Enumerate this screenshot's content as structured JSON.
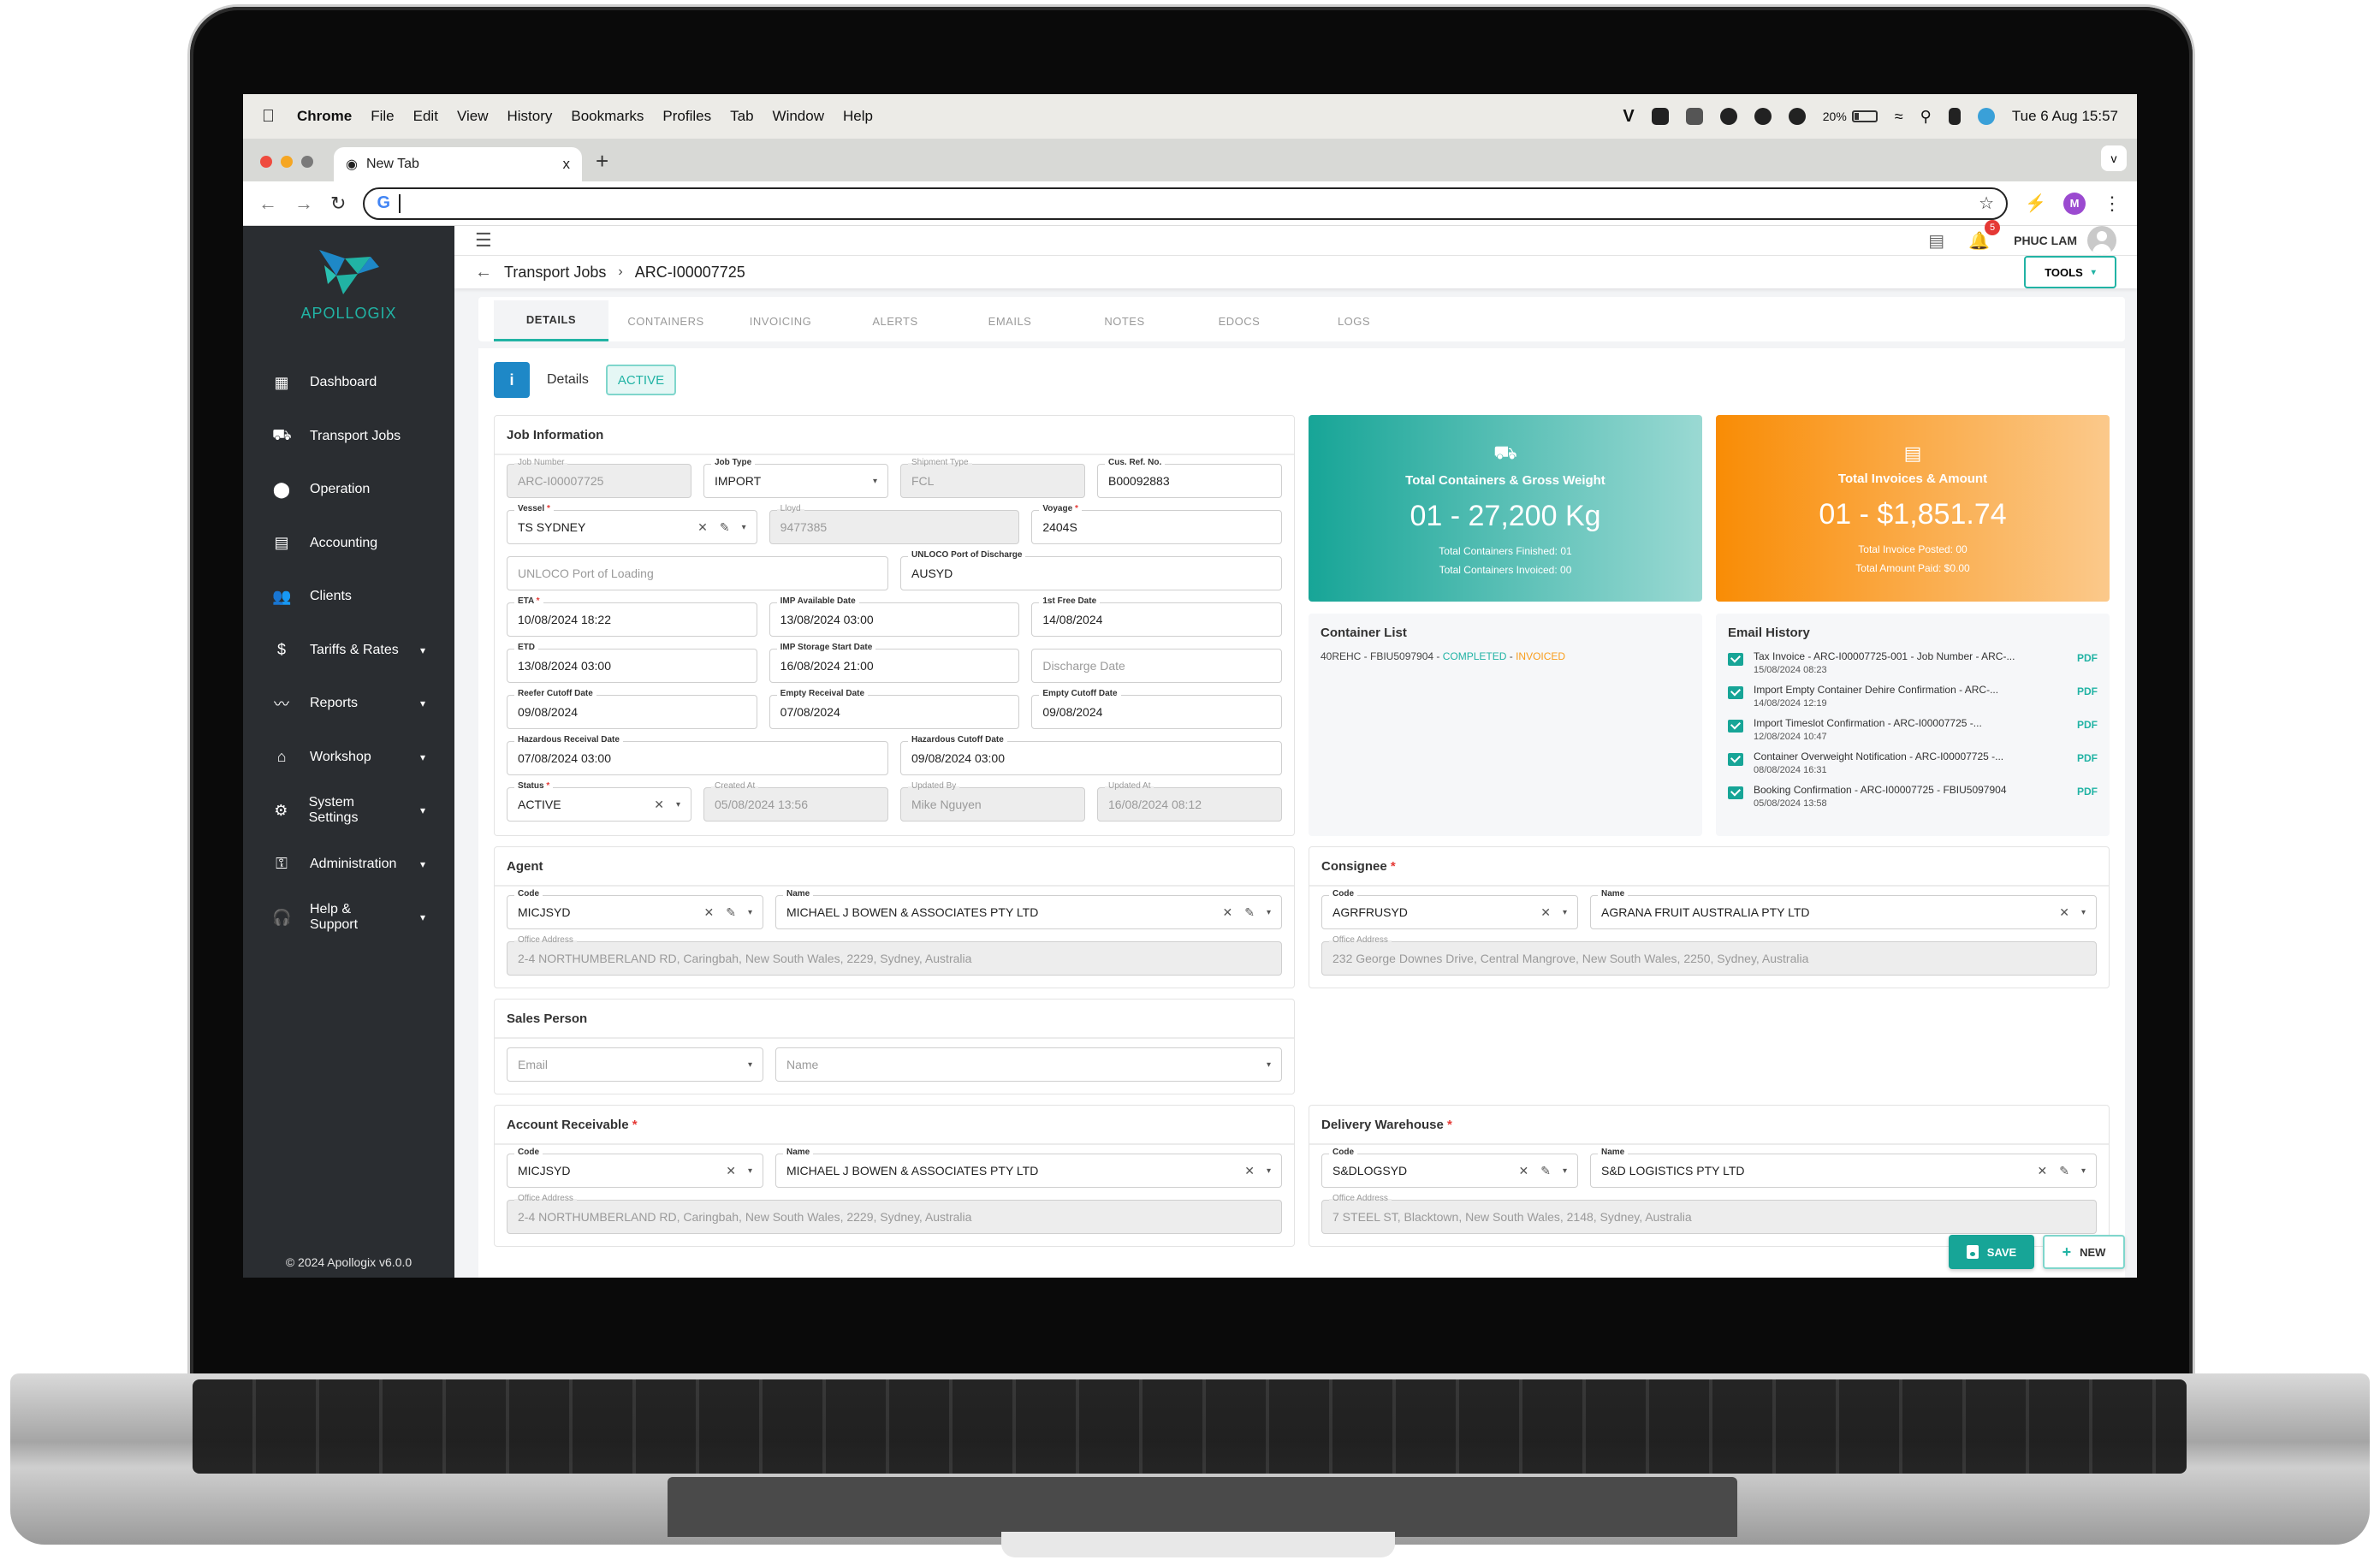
{
  "menubar": {
    "app_name": "Chrome",
    "items": [
      "File",
      "Edit",
      "View",
      "History",
      "Bookmarks",
      "Profiles",
      "Tab",
      "Window",
      "Help"
    ],
    "battery_percent": "20%",
    "datetime": "Tue 6 Aug  15:57",
    "tray_letter": "V"
  },
  "browser": {
    "tab_title": "New Tab",
    "tab_close": "x",
    "new_tab": "+",
    "tab_dropdown": "v",
    "address_value": "",
    "profile_initial": "M"
  },
  "sidebar": {
    "brand": "APOLLOGIX",
    "items": [
      {
        "label": "Dashboard",
        "icon": "dashboard-icon",
        "glyph": "▦",
        "expandable": false
      },
      {
        "label": "Transport Jobs",
        "icon": "truck-icon",
        "glyph": "⛟",
        "expandable": false
      },
      {
        "label": "Operation",
        "icon": "location-pin-icon",
        "glyph": "⬤",
        "expandable": false
      },
      {
        "label": "Accounting",
        "icon": "ledger-icon",
        "glyph": "▤",
        "expandable": false
      },
      {
        "label": "Clients",
        "icon": "people-icon",
        "glyph": "👥",
        "expandable": false
      },
      {
        "label": "Tariffs & Rates",
        "icon": "dollar-icon",
        "glyph": "$",
        "expandable": true
      },
      {
        "label": "Reports",
        "icon": "trend-line-icon",
        "glyph": "〰",
        "expandable": true
      },
      {
        "label": "Workshop",
        "icon": "workshop-icon",
        "glyph": "⌂",
        "expandable": true
      },
      {
        "label": "System Settings",
        "icon": "gear-icon",
        "glyph": "⚙",
        "expandable": true
      },
      {
        "label": "Administration",
        "icon": "key-icon",
        "glyph": "⚿",
        "expandable": true
      },
      {
        "label": "Help & Support",
        "icon": "headset-icon",
        "glyph": "🎧",
        "expandable": true
      }
    ],
    "chevron": "▾",
    "footer": "© 2024 Apollogix v6.0.0"
  },
  "topbar": {
    "notification_count": "5",
    "user_name": "PHUC LAM"
  },
  "breadcrumb": {
    "parent": "Transport Jobs",
    "separator": "›",
    "current": "ARC-I00007725",
    "tools_label": "TOOLS"
  },
  "tabs": [
    {
      "label": "DETAILS",
      "active": true
    },
    {
      "label": "CONTAINERS",
      "active": false
    },
    {
      "label": "INVOICING",
      "active": false
    },
    {
      "label": "ALERTS",
      "active": false
    },
    {
      "label": "EMAILS",
      "active": false
    },
    {
      "label": "NOTES",
      "active": false
    },
    {
      "label": "EDOCS",
      "active": false
    },
    {
      "label": "LOGS",
      "active": false
    }
  ],
  "details": {
    "info_glyph": "i",
    "label": "Details",
    "status_chip": "ACTIVE"
  },
  "job_information": {
    "title": "Job Information",
    "job_number": {
      "label": "Job Number",
      "value": "ARC-I00007725"
    },
    "job_type": {
      "label": "Job Type",
      "value": "IMPORT"
    },
    "shipment_type": {
      "label": "Shipment Type",
      "value": "FCL"
    },
    "cus_ref_no": {
      "label": "Cus. Ref. No.",
      "value": "B00092883"
    },
    "vessel": {
      "label": "Vessel",
      "value": "TS SYDNEY"
    },
    "lloyd": {
      "label": "Lloyd",
      "value": "9477385"
    },
    "voyage": {
      "label": "Voyage",
      "value": "2404S"
    },
    "port_of_loading": {
      "placeholder": "UNLOCO Port of Loading"
    },
    "port_of_discharge": {
      "label": "UNLOCO Port of Discharge",
      "value": "AUSYD"
    },
    "eta": {
      "label": "ETA",
      "value": "10/08/2024 18:22"
    },
    "imp_available_date": {
      "label": "IMP Available Date",
      "value": "13/08/2024 03:00"
    },
    "first_free_date": {
      "label": "1st Free Date",
      "value": "14/08/2024"
    },
    "etd": {
      "label": "ETD",
      "value": "13/08/2024 03:00"
    },
    "imp_storage_start_date": {
      "label": "IMP Storage Start Date",
      "value": "16/08/2024 21:00"
    },
    "discharge_date": {
      "placeholder": "Discharge Date"
    },
    "reefer_cutoff_date": {
      "label": "Reefer Cutoff Date",
      "value": "09/08/2024"
    },
    "empty_receival_date": {
      "label": "Empty Receival Date",
      "value": "07/08/2024"
    },
    "empty_cutoff_date": {
      "label": "Empty Cutoff Date",
      "value": "09/08/2024"
    },
    "hazardous_receival_date": {
      "label": "Hazardous Receival Date",
      "value": "07/08/2024 03:00"
    },
    "hazardous_cutoff_date": {
      "label": "Hazardous Cutoff Date",
      "value": "09/08/2024 03:00"
    },
    "status": {
      "label": "Status",
      "value": "ACTIVE"
    },
    "created_at": {
      "label": "Created At",
      "value": "05/08/2024 13:56"
    },
    "updated_by": {
      "label": "Updated By",
      "value": "Mike Nguyen"
    },
    "updated_at": {
      "label": "Updated At",
      "value": "16/08/2024 08:12"
    }
  },
  "stats": {
    "containers": {
      "title": "Total Containers & Gross Weight",
      "value": "01 - 27,200 Kg",
      "line1": "Total Containers Finished: 01",
      "line2": "Total Containers Invoiced: 00",
      "color": "#17a597"
    },
    "invoices": {
      "title": "Total Invoices & Amount",
      "value": "01 - $1,851.74",
      "line1": "Total Invoice Posted: 00",
      "line2": "Total Amount Paid: $0.00",
      "color": "#f98c05"
    }
  },
  "container_list": {
    "title": "Container List",
    "items": [
      {
        "prefix": "40REHC - FBIU5097904 - ",
        "status": "COMPLETED",
        "sep": " - ",
        "billing": "INVOICED"
      }
    ]
  },
  "email_history": {
    "title": "Email History",
    "link_label": "PDF",
    "items": [
      {
        "subject": "Tax Invoice - ARC-I00007725-001 - Job Number - ARC-...",
        "date": "15/08/2024 08:23"
      },
      {
        "subject": "Import Empty Container Dehire Confirmation - ARC-...",
        "date": "14/08/2024 12:19"
      },
      {
        "subject": "Import Timeslot Confirmation - ARC-I00007725 -...",
        "date": "12/08/2024 10:47"
      },
      {
        "subject": "Container Overweight Notification - ARC-I00007725 -...",
        "date": "08/08/2024 16:31"
      },
      {
        "subject": "Booking Confirmation - ARC-I00007725 - FBIU5097904",
        "date": "05/08/2024 13:58"
      }
    ]
  },
  "agent": {
    "title": "Agent",
    "code": {
      "label": "Code",
      "value": "MICJSYD"
    },
    "name": {
      "label": "Name",
      "value": "MICHAEL J BOWEN & ASSOCIATES PTY LTD"
    },
    "address": {
      "label": "Office Address",
      "value": "2-4 NORTHUMBERLAND RD, Caringbah, New South Wales, 2229, Sydney, Australia"
    }
  },
  "consignee": {
    "title": "Consignee",
    "code": {
      "label": "Code",
      "value": "AGRFRUSYD"
    },
    "name": {
      "label": "Name",
      "value": "AGRANA FRUIT AUSTRALIA PTY LTD"
    },
    "address": {
      "label": "Office Address",
      "value": "232 George Downes Drive, Central Mangrove, New South Wales, 2250, Sydney, Australia"
    }
  },
  "sales_person": {
    "title": "Sales Person",
    "email_placeholder": "Email",
    "name_placeholder": "Name"
  },
  "account_receivable": {
    "title": "Account Receivable",
    "code": {
      "label": "Code",
      "value": "MICJSYD"
    },
    "name": {
      "label": "Name",
      "value": "MICHAEL J BOWEN & ASSOCIATES PTY LTD"
    },
    "address": {
      "label": "Office Address",
      "value": "2-4 NORTHUMBERLAND RD, Caringbah, New South Wales, 2229, Sydney, Australia"
    }
  },
  "delivery_warehouse": {
    "title": "Delivery Warehouse",
    "code": {
      "label": "Code",
      "value": "S&DLOGSYD"
    },
    "name": {
      "label": "Name",
      "value": "S&D LOGISTICS PTY LTD"
    },
    "address": {
      "label": "Office Address",
      "value": "7 STEEL ST, Blacktown, New South Wales, 2148, Sydney, Australia"
    }
  },
  "actions": {
    "save_label": "SAVE",
    "new_label": "NEW"
  },
  "glyphs": {
    "clear": "✕",
    "edit": "✎",
    "dropdown": "▾",
    "required": "*"
  }
}
